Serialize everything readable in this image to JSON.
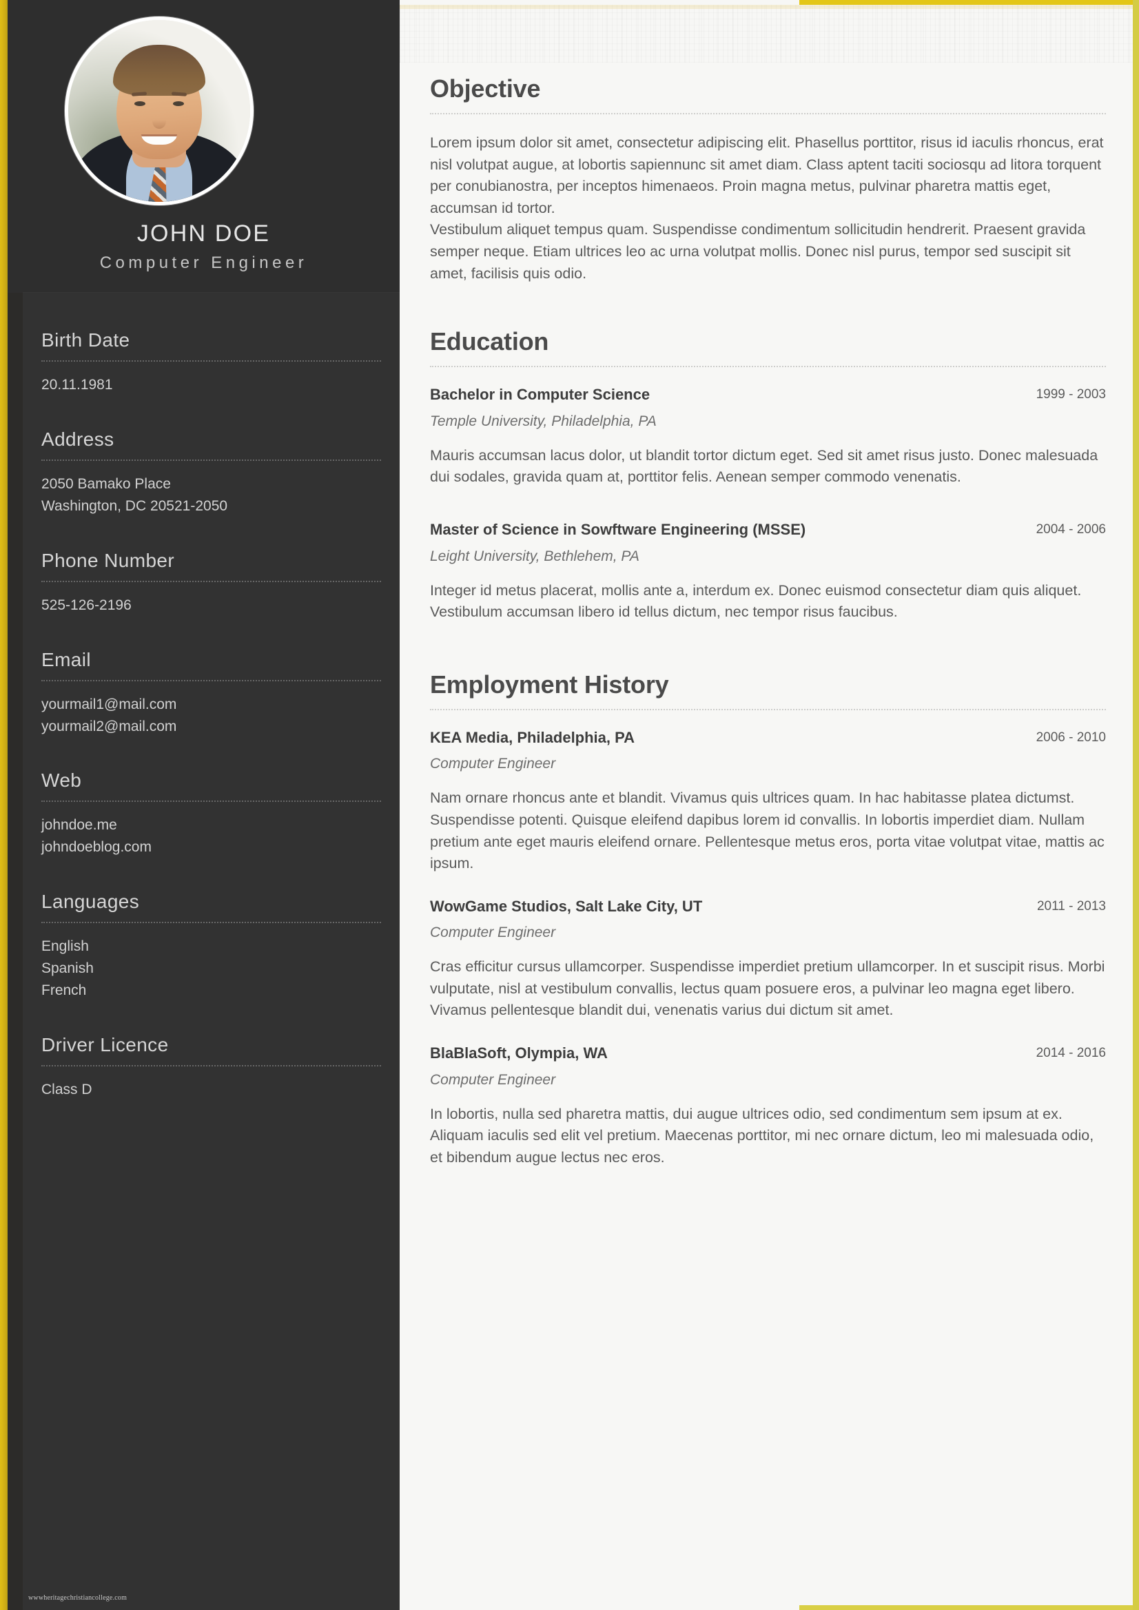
{
  "theme": {
    "sidebar_bg": "#323232",
    "main_bg": "#f7f7f5",
    "rail_left": "#cfae16",
    "rail_right": "#d4cc45",
    "heading_color": "#4a4a4a"
  },
  "sidebar": {
    "name": "JOHN DOE",
    "role": "Computer Engineer",
    "watermark": "wwwheritagechristiancollege.com",
    "sections": [
      {
        "label": "Birth Date",
        "values": [
          "20.11.1981"
        ]
      },
      {
        "label": "Address",
        "values": [
          "2050 Bamako Place",
          "Washington, DC 20521-2050"
        ]
      },
      {
        "label": "Phone Number",
        "values": [
          "525-126-2196"
        ]
      },
      {
        "label": "Email",
        "values": [
          "yourmail1@mail.com",
          "yourmail2@mail.com"
        ]
      },
      {
        "label": "Web",
        "values": [
          "johndoe.me",
          "johndoeblog.com"
        ]
      },
      {
        "label": "Languages",
        "values": [
          "English",
          "Spanish",
          "French"
        ]
      },
      {
        "label": "Driver Licence",
        "values": [
          "Class D"
        ]
      }
    ]
  },
  "main": {
    "objective": {
      "title": "Objective",
      "paragraph1": "Lorem ipsum dolor sit amet, consectetur adipiscing elit. Phasellus porttitor, risus id iaculis rhoncus, erat nisl volutpat augue, at lobortis sapiennunc sit amet diam. Class aptent taciti sociosqu ad litora torquent per conubianostra, per inceptos himenaeos. Proin magna metus, pulvinar pharetra mattis eget, accumsan id tortor.",
      "paragraph2": "Vestibulum aliquet tempus quam. Suspendisse condimentum sollicitudin hendrerit. Praesent gravida semper neque. Etiam ultrices leo ac urna volutpat mollis. Donec nisl purus, tempor sed suscipit sit amet, facilisis quis odio."
    },
    "education": {
      "title": "Education",
      "entries": [
        {
          "title": "Bachelor in Computer Science",
          "dates": "1999 - 2003",
          "institution": "Temple University, Philadelphia, PA",
          "description": "Mauris accumsan lacus dolor, ut blandit tortor dictum eget. Sed sit amet risus justo. Donec malesuada dui sodales, gravida quam at, porttitor felis. Aenean semper commodo venenatis."
        },
        {
          "title": "Master of Science in Sowftware Engineering (MSSE)",
          "dates": "2004 - 2006",
          "institution": "Leight University, Bethlehem, PA",
          "description": "Integer id metus placerat, mollis ante a, interdum ex. Donec euismod consectetur diam quis aliquet. Vestibulum accumsan libero id tellus dictum, nec tempor risus faucibus."
        }
      ]
    },
    "employment": {
      "title": "Employment History",
      "entries": [
        {
          "title": "KEA Media, Philadelphia, PA",
          "dates": "2006 - 2010",
          "position": "Computer Engineer",
          "description": "Nam ornare rhoncus ante et blandit. Vivamus quis ultrices quam. In hac habitasse platea dictumst. Suspendisse potenti. Quisque eleifend dapibus lorem id convallis. In lobortis imperdiet diam. Nullam pretium ante eget mauris eleifend ornare. Pellentesque metus eros, porta vitae volutpat vitae, mattis ac ipsum."
        },
        {
          "title": "WowGame Studios, Salt Lake City, UT",
          "dates": "2011 - 2013",
          "position": "Computer Engineer",
          "description": "Cras efficitur cursus ullamcorper. Suspendisse imperdiet pretium ullamcorper. In et suscipit risus. Morbi vulputate, nisl at vestibulum convallis, lectus quam posuere eros, a pulvinar leo magna eget libero. Vivamus pellentesque blandit dui, venenatis varius dui dictum sit amet."
        },
        {
          "title": "BlaBlaSoft, Olympia, WA",
          "dates": "2014 - 2016",
          "position": "Computer Engineer",
          "description": "In lobortis, nulla sed pharetra mattis, dui augue ultrices odio, sed condimentum sem ipsum at ex. Aliquam iaculis sed elit vel pretium. Maecenas porttitor, mi nec ornare dictum, leo mi malesuada odio, et bibendum augue lectus nec eros."
        }
      ]
    }
  }
}
